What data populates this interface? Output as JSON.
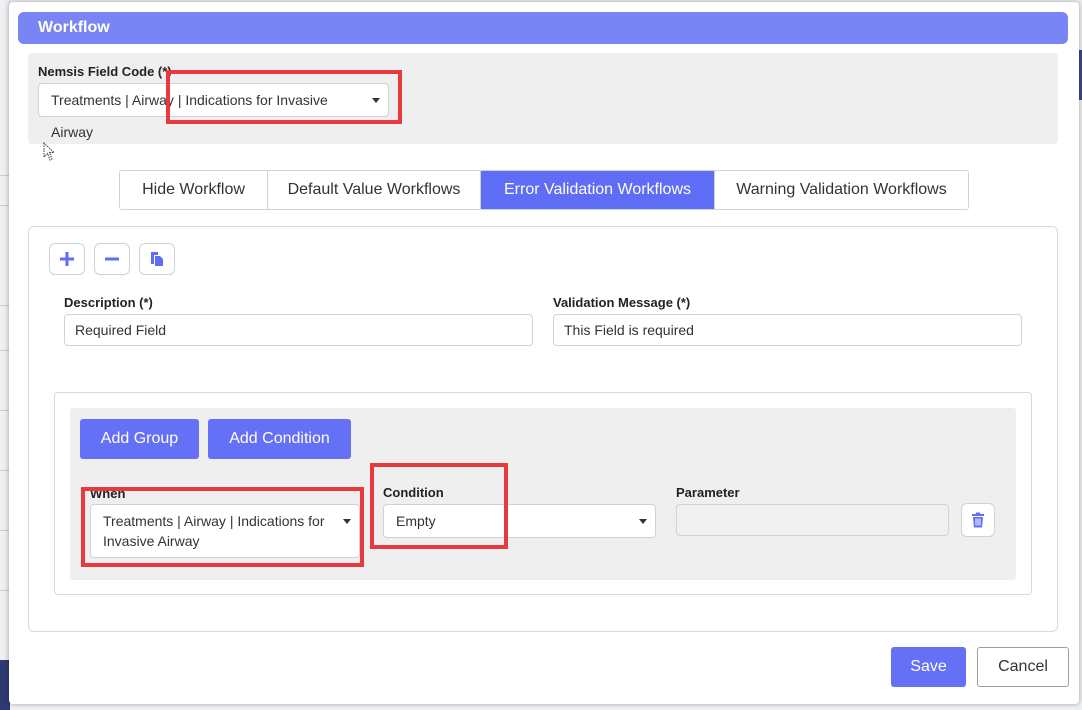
{
  "modal": {
    "title": "Workflow"
  },
  "nemsis": {
    "label": "Nemsis Field Code (*)",
    "value": "Treatments | Airway | Indications for Invasive Airway"
  },
  "tabs": [
    {
      "label": "Hide Workflow",
      "active": false
    },
    {
      "label": "Default Value Workflows",
      "active": false
    },
    {
      "label": "Error Validation Workflows",
      "active": true
    },
    {
      "label": "Warning Validation Workflows",
      "active": false
    }
  ],
  "toolbar": {
    "add_icon": "plus-icon",
    "remove_icon": "minus-icon",
    "copy_icon": "copy-icon"
  },
  "description": {
    "label": "Description (*)",
    "value": "Required Field"
  },
  "validation_message": {
    "label": "Validation Message (*)",
    "value": "This Field is required"
  },
  "conditions": {
    "add_group_label": "Add Group",
    "add_condition_label": "Add Condition",
    "when": {
      "label": "When",
      "value_line1": "Treatments | Airway | Indications for",
      "value_line2": "Invasive Airway"
    },
    "condition": {
      "label": "Condition",
      "value": "Empty"
    },
    "parameter": {
      "label": "Parameter",
      "value": ""
    },
    "delete_icon": "trash-icon"
  },
  "footer": {
    "save_label": "Save",
    "cancel_label": "Cancel"
  },
  "colors": {
    "accent": "#6470f5",
    "header": "#7a85f5",
    "highlight": "#e8393f"
  }
}
